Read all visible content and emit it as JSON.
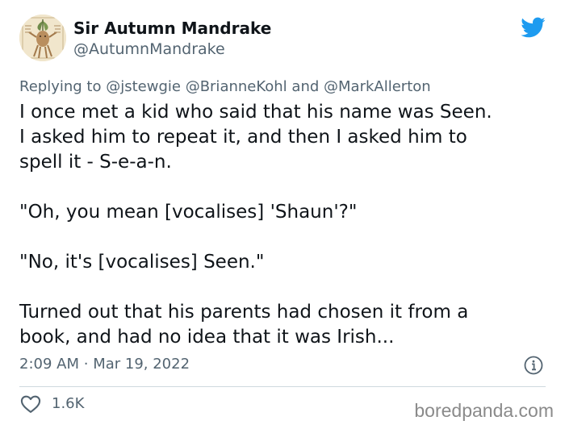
{
  "author": {
    "display_name": "Sir Autumn Mandrake",
    "handle": "@AutumnMandrake"
  },
  "brand": {
    "logo_icon": "twitter-bird-icon",
    "accent_color": "#1d9bf0"
  },
  "reply": {
    "prefix": "Replying to",
    "mention_1": "@jstewgie",
    "mention_2": "@BrianneKohl",
    "conjunction": "and",
    "mention_3": "@MarkAllerton"
  },
  "tweet": {
    "p1_l1": "I once met a kid who said that his name was Seen.",
    "p1_l2": "I asked him to repeat it, and then I asked him to",
    "p1_l3": "spell it - S-e-a-n.",
    "p2": "\"Oh, you mean [vocalises] 'Shaun'?\"",
    "p3": "\"No, it's [vocalises] Seen.\"",
    "p4_l1": "Turned out that his parents had chosen it from a",
    "p4_l2": "book, and had no idea that it was Irish..."
  },
  "meta": {
    "time": "2:09 AM",
    "separator": "·",
    "date": "Mar 19, 2022",
    "info_icon": "info-icon"
  },
  "engagement": {
    "like_icon": "heart-icon",
    "likes": "1.6K"
  },
  "watermark": "boredpanda.com"
}
